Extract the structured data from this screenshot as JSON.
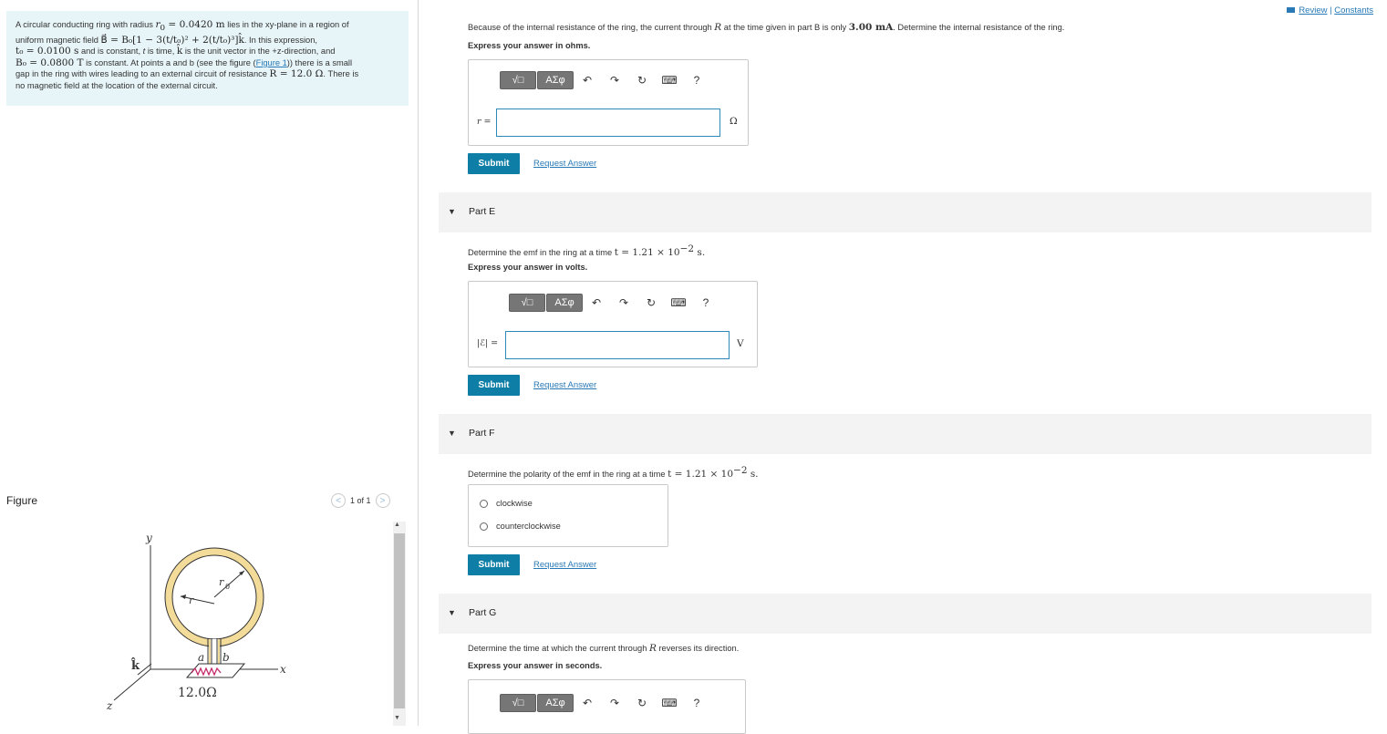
{
  "header": {
    "review_label": "Review",
    "separator": "|",
    "constants_label": "Constants"
  },
  "problem": {
    "line1_a": "A circular conducting ring with radius ",
    "r0_sym": "r",
    "r0_sub": "0",
    "r0_value": " = 0.0420 m",
    "line1_b": " lies in the xy-plane in a region of",
    "line2_a": "uniform magnetic field ",
    "field_expr": "B⃗ = B₀[1 − 3(t/t₀)² + 2(t/t₀)³]k̂",
    "line2_b": ". In this expression,",
    "line3_expr": "t₀ = 0.0100 s",
    "line3_b": " and is constant, ",
    "line3_t": "t",
    "line3_c": " is time, ",
    "line3_k": "k̂",
    "line3_d": " is the unit vector in the +z-direction, and",
    "line4_expr": "B₀ = 0.0800 T",
    "line4_b": " is constant. At points a and b (see the figure (",
    "figure_link": "Figure 1",
    "line4_c": ")) there is a small",
    "line5_a": "gap in the ring with wires leading to an external circuit of resistance ",
    "line5_expr": "R = 12.0 Ω",
    "line5_b": ". There is",
    "line6": "no magnetic field at the location of the external circuit."
  },
  "figure": {
    "title": "Figure",
    "pager": "1 of 1",
    "prev_icon": "<",
    "next_icon": ">",
    "labels": {
      "y": "y",
      "x": "x",
      "z": "z",
      "k": "k̂",
      "r": "r",
      "r0": "r",
      "r0_sub": "0",
      "a": "a",
      "b": "b",
      "res": "12.0Ω"
    }
  },
  "partD": {
    "question_a": "Because of the internal resistance of the ring, the current through ",
    "R": "R",
    "question_b": " at the time given in part B is only ",
    "current": "3.00 mA",
    "question_c": ". Determine the internal resistance of the ring.",
    "express": "Express your answer in ohms.",
    "input_label": "r =",
    "unit": "Ω",
    "submit": "Submit",
    "request": "Request Answer"
  },
  "partE": {
    "title": "Part E",
    "question_a": "Determine the emf in the ring at a time ",
    "time": "t = 1.21 × 10",
    "exp": "−2",
    "time_unit": " s.",
    "express": "Express your answer in volts.",
    "input_label": "|ℰ| =",
    "unit": "V",
    "submit": "Submit",
    "request": "Request Answer"
  },
  "partF": {
    "title": "Part F",
    "question_a": "Determine the polarity of the emf in the ring at a time ",
    "time": "t = 1.21 × 10",
    "exp": "−2",
    "time_unit": " s.",
    "options": [
      "clockwise",
      "counterclockwise"
    ],
    "submit": "Submit",
    "request": "Request Answer"
  },
  "partG": {
    "title": "Part G",
    "question_a": "Determine the time at which the current through ",
    "R": "R",
    "question_b": " reverses its direction.",
    "express": "Express your answer in seconds."
  },
  "toolbar": {
    "template_label": "√□",
    "greek_label": "ΑΣφ",
    "undo": "↶",
    "redo": "↷",
    "reset": "↻",
    "keyboard": "⌨",
    "help": "?"
  },
  "colors": {
    "accent": "#0e7ea7",
    "link": "#2879b6",
    "problem_bg": "#e7f5f9",
    "input_border": "#2d8ab8"
  }
}
